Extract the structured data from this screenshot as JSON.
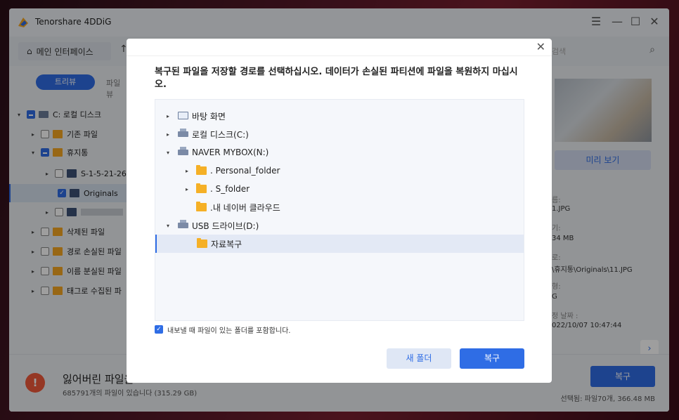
{
  "app": {
    "title": "Tenorshare 4DDiG",
    "window_controls": [
      "menu",
      "minimize",
      "maximize",
      "close"
    ]
  },
  "toolbar": {
    "home_label": "메인 인터페이스",
    "search_placeholder": "검색"
  },
  "left_panel": {
    "tab_tree": "트리뷰",
    "tab_file": "파일뷰",
    "items": [
      {
        "label": "C: 로컬 디스크",
        "check": "partial"
      },
      {
        "label": "기존 파일",
        "check": "none"
      },
      {
        "label": "휴지통",
        "check": "partial"
      },
      {
        "label": "S-1-5-21-26",
        "check": "none"
      },
      {
        "label": "Originals",
        "check": "checked"
      },
      {
        "label": "",
        "check": "none"
      },
      {
        "label": "삭제된 파일",
        "check": "none"
      },
      {
        "label": "경로 손실된 파일",
        "check": "none"
      },
      {
        "label": "이름 분실된 파일",
        "check": "none"
      },
      {
        "label": "태그로 수집된 파",
        "check": "none"
      }
    ]
  },
  "right_panel": {
    "preview_button": "미리 보기",
    "meta": [
      {
        "label": "름:",
        "value": "1.JPG"
      },
      {
        "label": "기:",
        "value": "34 MB"
      },
      {
        "label": "로:",
        "value": "\\휴지통\\Originals\\11.JPG"
      },
      {
        "label": "형:",
        "value": "G"
      },
      {
        "label": "정 날짜 :",
        "value": "022/10/07 10:47:44"
      }
    ]
  },
  "bottom": {
    "lost_title": "잃어버린 파일을",
    "lost_sub": "685791개의 파일이 있습니다 (315.29 GB)",
    "recover_button": "복구",
    "selected_info": "선택됨: 파일70개, 366.48 MB"
  },
  "dialog": {
    "close": "✕",
    "title": "복구된 파일을 저장할 경로를 선택하십시오. 데이터가 손실된 파티션에 파일을 복원하지 마십시오.",
    "tree": [
      {
        "label": "바탕 화면",
        "icon": "monitor-icon",
        "arrow": "▸",
        "expanded": false,
        "selected": false
      },
      {
        "label": "로컬 디스크(C:)",
        "icon": "drive-icon",
        "arrow": "▸",
        "expanded": false,
        "selected": false
      },
      {
        "label": "NAVER MYBOX(N:)",
        "icon": "drive-icon",
        "arrow": "▾",
        "expanded": true,
        "selected": false
      },
      {
        "label": ". Personal_folder",
        "icon": "folder-icon",
        "arrow": "▸",
        "expanded": false,
        "selected": false
      },
      {
        "label": ". S_folder",
        "icon": "folder-icon",
        "arrow": "▸",
        "expanded": false,
        "selected": false
      },
      {
        "label": ".내 네이버 클라우드",
        "icon": "folder-icon",
        "arrow": "",
        "expanded": false,
        "selected": false
      },
      {
        "label": "USB 드라이브(D:)",
        "icon": "drive-icon",
        "arrow": "▾",
        "expanded": true,
        "selected": false
      },
      {
        "label": "자료복구",
        "icon": "folder-icon",
        "arrow": "",
        "expanded": false,
        "selected": true
      }
    ],
    "include_label": "내보낼 때 파일이 있는 폴더를 포함합니다.",
    "new_folder_button": "새 폴더",
    "recover_button": "복구"
  }
}
